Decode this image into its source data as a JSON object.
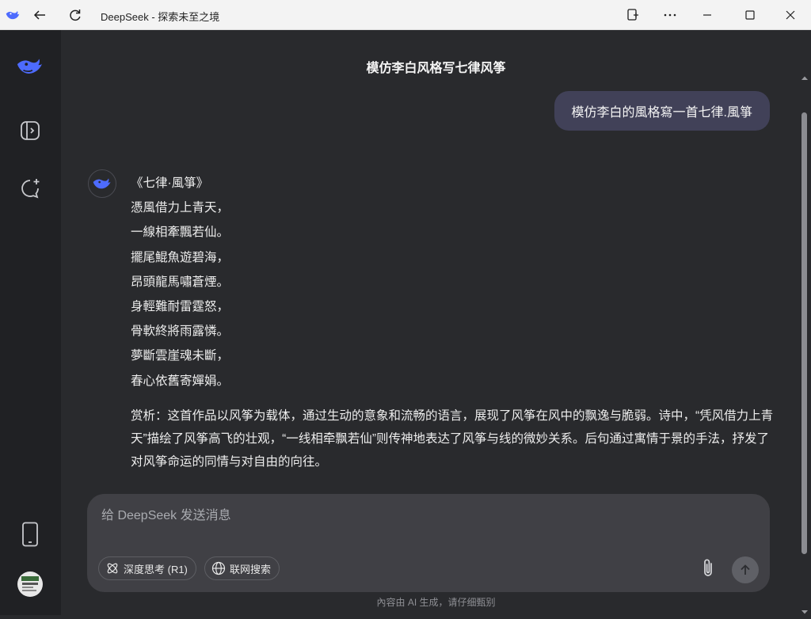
{
  "window": {
    "title": "DeepSeek - 探索未至之境",
    "accent": "#4d6bfe"
  },
  "chat": {
    "title": "模仿李白风格写七律风筝",
    "user_message": "模仿李白的風格寫一首七律.風箏",
    "poem": [
      "《七律·風箏》",
      "憑風借力上青天，",
      "一線相牽飄若仙。",
      "擺尾鯤魚遊碧海，",
      "昂頭龍馬嘯蒼煙。",
      "身輕難耐雷霆怒，",
      "骨軟終將雨露憐。",
      "夢斷雲崖魂未斷，",
      "春心依舊寄嬋娟。"
    ],
    "analysis": "赏析：这首作品以风筝为载体，通过生动的意象和流畅的语言，展现了风筝在风中的飘逸与脆弱。诗中，“凭风借力上青天”描绘了风筝高飞的壮观，“一线相牵飘若仙”则传神地表达了风筝与线的微妙关系。后句通过寓情于景的手法，抒发了对风筝命运的同情与对自由的向往。"
  },
  "composer": {
    "placeholder": "给 DeepSeek 发送消息",
    "deep_think_label": "深度思考 (R1)",
    "web_search_label": "联网搜索"
  },
  "footer": {
    "disclaimer": "內容由 AI 生成，请仔细甄别"
  },
  "icons": {
    "back": "arrow-left-icon",
    "refresh": "refresh-icon",
    "install_app": "app-install-icon",
    "more": "more-icon",
    "minimize": "minimize-icon",
    "maximize": "maximize-icon",
    "close": "close-icon"
  }
}
